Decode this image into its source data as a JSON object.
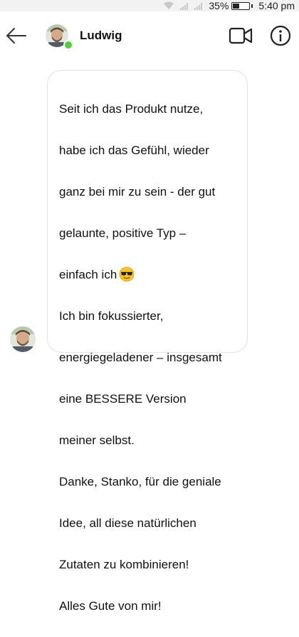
{
  "status_bar": {
    "battery_percent": "35%",
    "battery_level": 0.35,
    "time": "5:40 pm",
    "icons": [
      "wifi-icon",
      "signal-icon",
      "signal-icon",
      "battery-icon"
    ]
  },
  "header": {
    "contact_name": "Ludwig",
    "online": true,
    "icons": [
      "arrow-left-icon",
      "video-camera-icon",
      "info-icon"
    ]
  },
  "message": {
    "lines": [
      "Seit ich das Produkt nutze,",
      "habe ich das Gefühl, wieder",
      "ganz bei mir zu sein - der gut",
      "gelaunte, positive Typ –",
      "einfach ich",
      "Ich bin fokussierter,",
      "energiegeladener – insgesamt",
      "eine BESSERE Version",
      "meiner selbst.",
      "Danke, Stanko, für die geniale",
      "Idee, all diese natürlichen",
      "Zutaten zu kombinieren!",
      "Alles Gute von mir!"
    ],
    "emoji": "sunglasses-emoji"
  },
  "colors": {
    "online": "#4cd137",
    "bubble_border": "#e3e3e3",
    "status_bar_bg": "#f2f2f2"
  }
}
